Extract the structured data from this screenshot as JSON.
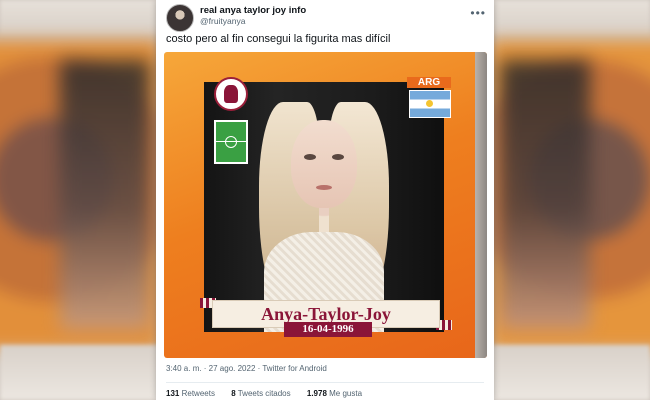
{
  "tweet": {
    "display_name": "real anya taylor joy info",
    "handle": "@fruityanya",
    "text": "costo pero al fin consegui la figurita mas difícil",
    "timestamp": "3:40 a. m. · 27 ago. 2022 · Twitter for Android",
    "stats": {
      "retweets_count": "131",
      "retweets_label": "Retweets",
      "quotes_count": "8",
      "quotes_label": "Tweets citados",
      "likes_count": "1.978",
      "likes_label": "Me gusta"
    },
    "more_icon": "more-horizontal-icon"
  },
  "sticker": {
    "country_code": "ARG",
    "player_name": "Anya-Taylor-Joy",
    "birth_date": "16-04-1996",
    "colors": {
      "background": "#ee7f1f",
      "accent": "#8a1538",
      "flag_blue": "#75aadb"
    }
  }
}
